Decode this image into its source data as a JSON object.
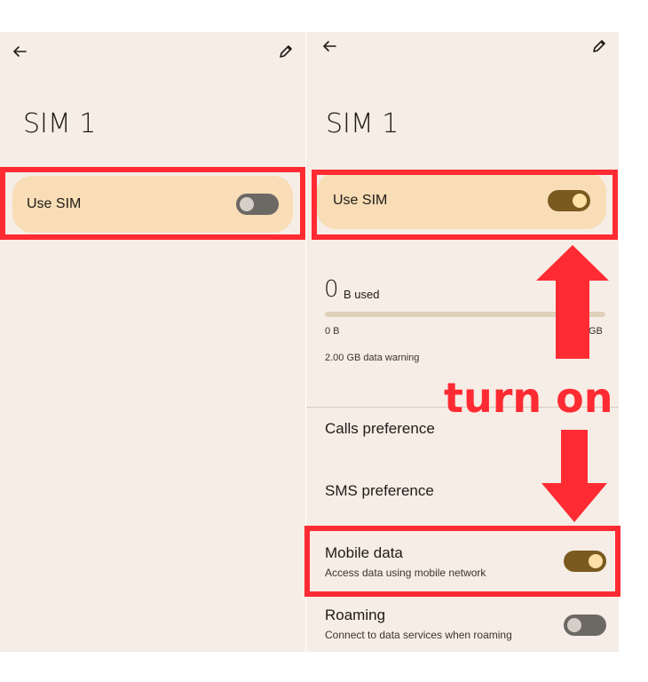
{
  "left_screen": {
    "title": "SIM 1",
    "use_sim": {
      "label": "Use SIM",
      "state": "off"
    }
  },
  "right_screen": {
    "title": "SIM 1",
    "use_sim": {
      "label": "Use SIM",
      "state": "on"
    },
    "usage": {
      "big_value": "0",
      "big_unit": "B used",
      "bar_fill_fraction": 0,
      "min_label": "0 B",
      "max_label": "GB",
      "warning_text": "2.00 GB data warning"
    },
    "calls_preference": "Calls preference",
    "sms_preference": "SMS preference",
    "mobile_data": {
      "title": "Mobile data",
      "subtitle": "Access data using mobile network",
      "state": "on"
    },
    "roaming": {
      "title": "Roaming",
      "subtitle": "Connect to data services when roaming",
      "state": "off"
    }
  },
  "annotation": {
    "text": "turn on",
    "color": "#ff2b33"
  },
  "icons": {
    "back": "arrow-left-icon",
    "edit": "pencil-icon"
  },
  "colors": {
    "background": "#f6ede6",
    "card": "#f8ddb6",
    "toggle_on": "#7a5a1f",
    "toggle_off": "#6c6863",
    "highlight": "#ff2b33"
  }
}
